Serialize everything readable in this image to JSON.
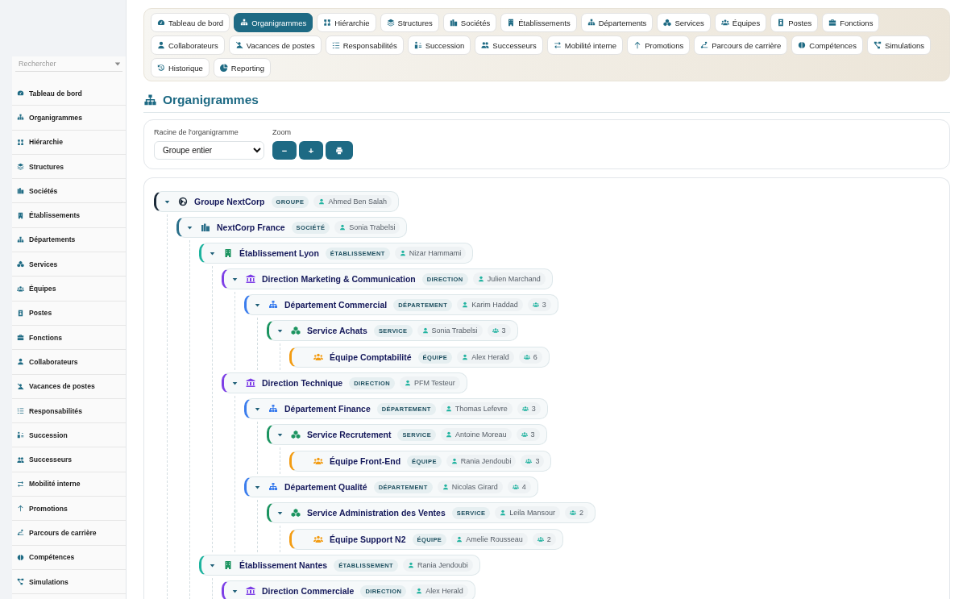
{
  "sidebar": {
    "search": {
      "placeholder": "Rechercher"
    },
    "items": [
      {
        "label": "Tableau de bord",
        "selected": false
      },
      {
        "label": "Organigrammes",
        "selected": false
      },
      {
        "label": "Hiérarchie",
        "selected": false
      },
      {
        "label": "Structures",
        "selected": false
      },
      {
        "label": "Sociétés",
        "selected": false
      },
      {
        "label": "Établissements",
        "selected": false
      },
      {
        "label": "Départements",
        "selected": false
      },
      {
        "label": "Services",
        "selected": false
      },
      {
        "label": "Équipes",
        "selected": false
      },
      {
        "label": "Postes",
        "selected": false
      },
      {
        "label": "Fonctions",
        "selected": false
      },
      {
        "label": "Collaborateurs",
        "selected": false
      },
      {
        "label": "Vacances de postes",
        "selected": false
      },
      {
        "label": "Responsabilités",
        "selected": false
      },
      {
        "label": "Succession",
        "selected": false
      },
      {
        "label": "Successeurs",
        "selected": false
      },
      {
        "label": "Mobilité interne",
        "selected": false
      },
      {
        "label": "Promotions",
        "selected": false
      },
      {
        "label": "Parcours de carrière",
        "selected": false
      },
      {
        "label": "Compétences",
        "selected": false
      },
      {
        "label": "Simulations",
        "selected": false
      }
    ]
  },
  "tabs": [
    {
      "label": "Tableau de bord",
      "selected": false
    },
    {
      "label": "Organigrammes",
      "selected": true
    },
    {
      "label": "Hiérarchie",
      "selected": false
    },
    {
      "label": "Structures",
      "selected": false
    },
    {
      "label": "Sociétés",
      "selected": false
    },
    {
      "label": "Établissements",
      "selected": false
    },
    {
      "label": "Départements",
      "selected": false
    },
    {
      "label": "Services",
      "selected": false
    },
    {
      "label": "Équipes",
      "selected": false
    },
    {
      "label": "Postes",
      "selected": false
    },
    {
      "label": "Fonctions",
      "selected": false
    },
    {
      "label": "Collaborateurs",
      "selected": false
    },
    {
      "label": "Vacances de postes",
      "selected": false
    },
    {
      "label": "Responsabilités",
      "selected": false
    },
    {
      "label": "Succession",
      "selected": false
    },
    {
      "label": "Successeurs",
      "selected": false
    },
    {
      "label": "Mobilité interne",
      "selected": false
    },
    {
      "label": "Promotions",
      "selected": false
    },
    {
      "label": "Parcours de carrière",
      "selected": false
    },
    {
      "label": "Compétences",
      "selected": false
    },
    {
      "label": "Simulations",
      "selected": false
    },
    {
      "label": "Historique",
      "selected": false
    },
    {
      "label": "Reporting",
      "selected": false
    }
  ],
  "page_title": "Organigrammes",
  "controls": {
    "root_label": "Racine de l'organigramme",
    "root_value": "Groupe entier",
    "zoom_label": "Zoom",
    "zoom_out": "−",
    "zoom_in": "+"
  },
  "tree": [
    {
      "name": "Groupe NextCorp",
      "kind": "groupe",
      "type_label": "GROUPE",
      "manager": "Ahmed Ben Salah",
      "expanded": true,
      "children": [
        {
          "name": "NextCorp France",
          "kind": "societe",
          "type_label": "SOCIÉTÉ",
          "manager": "Sonia Trabelsi",
          "expanded": true,
          "children": [
            {
              "name": "Établissement Lyon",
              "kind": "etablissement",
              "type_label": "ÉTABLISSEMENT",
              "manager": "Nizar Hammami",
              "expanded": true,
              "children": [
                {
                  "name": "Direction Marketing & Communication",
                  "kind": "direction",
                  "type_label": "DIRECTION",
                  "manager": "Julien Marchand",
                  "expanded": true,
                  "children": [
                    {
                      "name": "Département Commercial",
                      "kind": "departement",
                      "type_label": "DÉPARTEMENT",
                      "manager": "Karim Haddad",
                      "members": "3",
                      "expanded": true,
                      "children": [
                        {
                          "name": "Service Achats",
                          "kind": "service",
                          "type_label": "SERVICE",
                          "manager": "Sonia Trabelsi",
                          "members": "3",
                          "expanded": true,
                          "children": [
                            {
                              "name": "Équipe Comptabilité",
                              "kind": "equipe",
                              "type_label": "ÉQUIPE",
                              "manager": "Alex Herald",
                              "members": "6"
                            }
                          ]
                        }
                      ]
                    }
                  ]
                },
                {
                  "name": "Direction Technique",
                  "kind": "direction",
                  "type_label": "DIRECTION",
                  "manager": "PFM Testeur",
                  "expanded": true,
                  "children": [
                    {
                      "name": "Département Finance",
                      "kind": "departement",
                      "type_label": "DÉPARTEMENT",
                      "manager": "Thomas Lefevre",
                      "members": "3",
                      "expanded": true,
                      "children": [
                        {
                          "name": "Service Recrutement",
                          "kind": "service",
                          "type_label": "SERVICE",
                          "manager": "Antoine Moreau",
                          "members": "3",
                          "expanded": true,
                          "children": [
                            {
                              "name": "Équipe Front-End",
                              "kind": "equipe",
                              "type_label": "ÉQUIPE",
                              "manager": "Rania Jendoubi",
                              "members": "3"
                            }
                          ]
                        }
                      ]
                    },
                    {
                      "name": "Département Qualité",
                      "kind": "departement",
                      "type_label": "DÉPARTEMENT",
                      "manager": "Nicolas Girard",
                      "members": "4",
                      "expanded": true,
                      "children": [
                        {
                          "name": "Service Administration des Ventes",
                          "kind": "service",
                          "type_label": "SERVICE",
                          "manager": "Leila Mansour",
                          "members": "2",
                          "expanded": true,
                          "children": [
                            {
                              "name": "Équipe Support N2",
                              "kind": "equipe",
                              "type_label": "ÉQUIPE",
                              "manager": "Amelie Rousseau",
                              "members": "2"
                            }
                          ]
                        }
                      ]
                    }
                  ]
                }
              ]
            },
            {
              "name": "Établissement Nantes",
              "kind": "etablissement",
              "type_label": "ÉTABLISSEMENT",
              "manager": "Rania Jendoubi",
              "expanded": true,
              "children": [
                {
                  "name": "Direction Commerciale",
                  "kind": "direction",
                  "type_label": "DIRECTION",
                  "manager": "Alex Herald",
                  "expanded": true
                }
              ]
            }
          ]
        }
      ]
    }
  ]
}
